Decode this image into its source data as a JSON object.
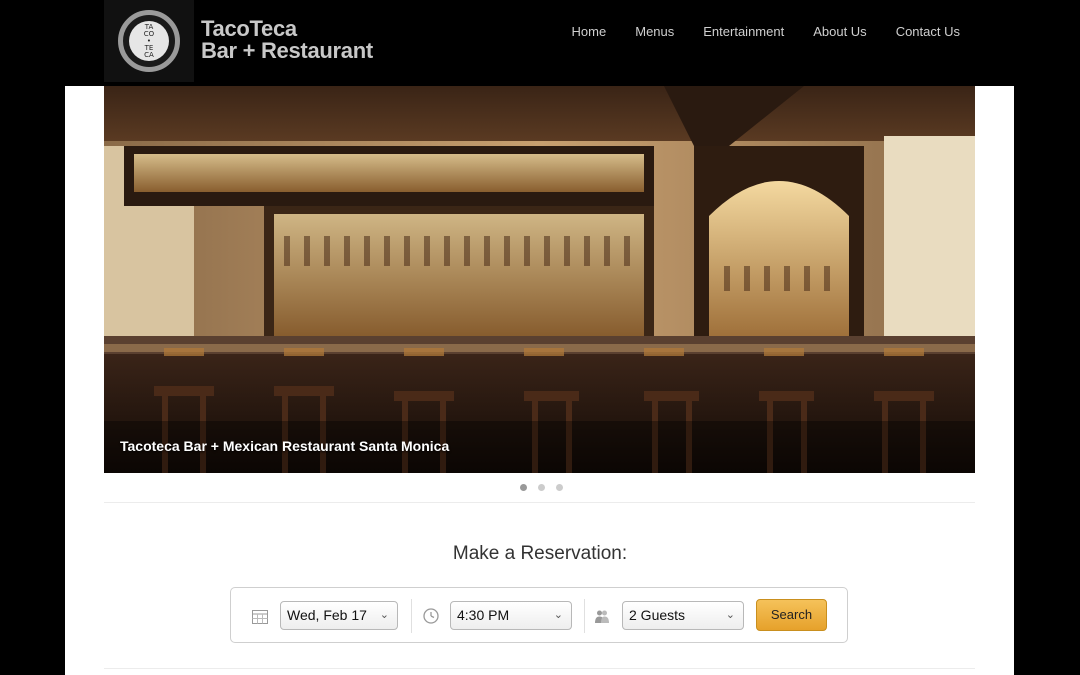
{
  "header": {
    "logo_text": [
      "TA",
      "CO",
      "•",
      "TE",
      "CA"
    ],
    "brand_line1": "TacoTeca",
    "brand_line2": "Bar + Restaurant",
    "nav": [
      "Home",
      "Menus",
      "Entertainment",
      "About Us",
      "Contact Us"
    ]
  },
  "hero": {
    "caption": "Tacoteca Bar + Mexican Restaurant Santa Monica",
    "slide_count": 3,
    "active_slide": 1
  },
  "reservation": {
    "title": "Make a Reservation:",
    "date_value": "Wed, Feb 17",
    "time_value": "4:30 PM",
    "party_value": "2 Guests",
    "search_label": "Search"
  },
  "icons": {
    "date": "calendar-icon",
    "time": "clock-icon",
    "party": "people-icon",
    "chevron": "chevron-down-icon"
  },
  "colors": {
    "header_bg": "#000000",
    "page_bg": "#ffffff",
    "search_button": "#eeb140",
    "nav_text": "#cfcfcf"
  }
}
